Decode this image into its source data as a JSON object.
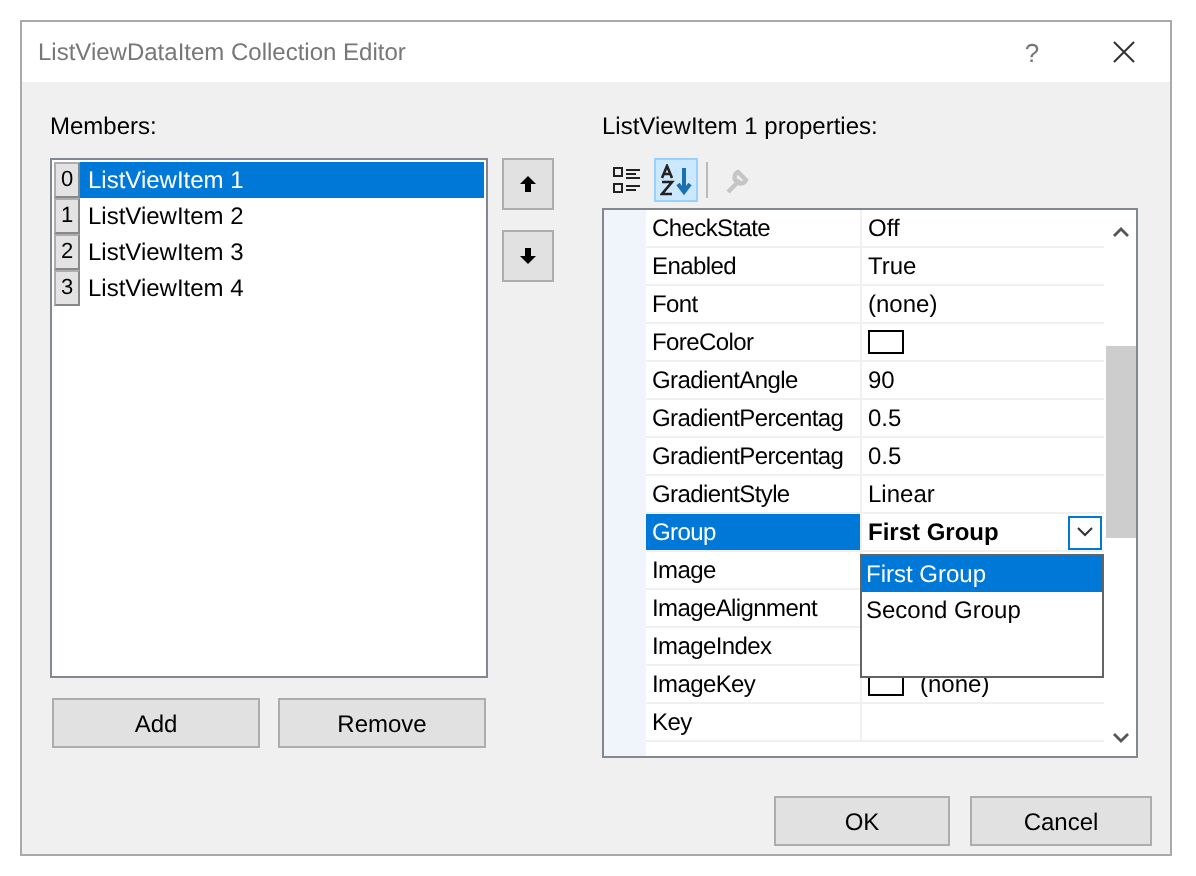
{
  "window": {
    "title": "ListViewDataItem Collection Editor",
    "help": "?"
  },
  "members": {
    "label": "Members:",
    "items": [
      {
        "index": "0",
        "text": "ListViewItem 1",
        "selected": true
      },
      {
        "index": "1",
        "text": "ListViewItem 2",
        "selected": false
      },
      {
        "index": "2",
        "text": "ListViewItem 3",
        "selected": false
      },
      {
        "index": "3",
        "text": "ListViewItem 4",
        "selected": false
      }
    ]
  },
  "member_buttons": [
    "Add",
    "Remove"
  ],
  "properties": {
    "label": "ListViewItem 1 properties:",
    "toolbar": [
      {
        "kind": "categorized",
        "selected": false,
        "disabled": false
      },
      {
        "kind": "alphabetical",
        "selected": true,
        "disabled": false
      },
      {
        "kind": "pages",
        "selected": false,
        "disabled": true
      }
    ],
    "rows": [
      {
        "name": "CheckState",
        "kind": "text",
        "value": "Off",
        "selected": false
      },
      {
        "name": "Enabled",
        "kind": "text",
        "value": "True",
        "selected": false
      },
      {
        "name": "Font",
        "kind": "text",
        "value": "(none)",
        "selected": false
      },
      {
        "name": "ForeColor",
        "kind": "swatch",
        "selected": false
      },
      {
        "name": "GradientAngle",
        "kind": "text",
        "value": "90",
        "selected": false
      },
      {
        "name": "GradientPercentag",
        "kind": "text",
        "value": "0.5",
        "selected": false
      },
      {
        "name": "GradientPercentag",
        "kind": "text",
        "value": "0.5",
        "selected": false
      },
      {
        "name": "GradientStyle",
        "kind": "text",
        "value": "Linear",
        "selected": false
      },
      {
        "name": "Group",
        "kind": "dropdown",
        "value": "First Group",
        "selected": true
      },
      {
        "name": "Image",
        "kind": "text",
        "selected": false
      },
      {
        "name": "ImageAlignment",
        "kind": "text",
        "selected": false
      },
      {
        "name": "ImageIndex",
        "kind": "text",
        "selected": false
      },
      {
        "name": "ImageKey",
        "kind": "swatch",
        "value": "(none)",
        "selected": false
      },
      {
        "name": "Key",
        "kind": "text",
        "selected": false
      }
    ],
    "dropdown_options": [
      {
        "text": "First Group",
        "selected": true
      },
      {
        "text": "Second Group",
        "selected": false
      }
    ]
  },
  "dialog_buttons": [
    "OK",
    "Cancel"
  ]
}
